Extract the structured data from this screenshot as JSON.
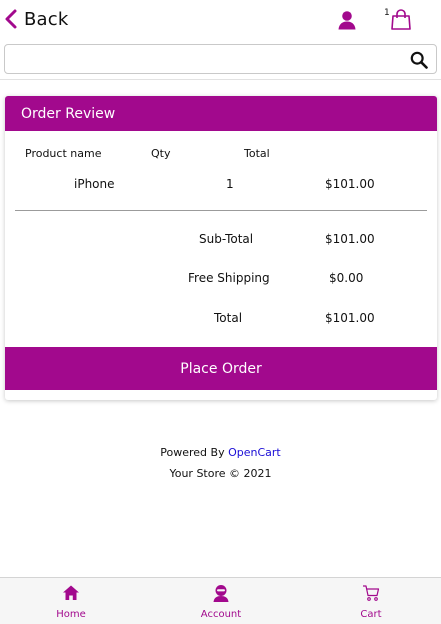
{
  "colors": {
    "accent": "#a2098d",
    "link": "#1a0dd6"
  },
  "header": {
    "back_label": "Back",
    "cart_count": "1",
    "icons": [
      "chevron-left-icon",
      "user-icon",
      "shopping-bag-icon"
    ]
  },
  "search": {
    "value": "",
    "placeholder": "",
    "icon": "search-icon"
  },
  "order_review": {
    "title": "Order Review",
    "columns": [
      "Product name",
      "Qty",
      "Total"
    ],
    "items": [
      {
        "name": "iPhone",
        "qty": "1",
        "total": "$101.00"
      }
    ],
    "totals": [
      {
        "label": "Sub-Total",
        "value": "$101.00"
      },
      {
        "label": "Free Shipping",
        "value": "$0.00"
      },
      {
        "label": "Total",
        "value": "$101.00"
      }
    ],
    "place_order_label": "Place Order"
  },
  "footer": {
    "powered_by": "Powered By",
    "powered_link": "OpenCart",
    "store": "Your Store © 2021"
  },
  "bottom_nav": [
    {
      "label": "Home",
      "icon": "home-icon"
    },
    {
      "label": "Account",
      "icon": "account-icon"
    },
    {
      "label": "Cart",
      "icon": "cart-icon"
    }
  ]
}
